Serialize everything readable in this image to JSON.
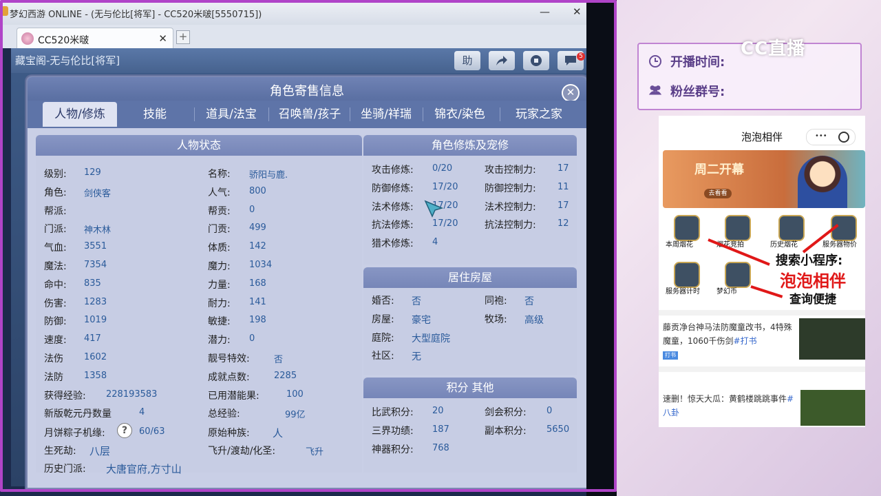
{
  "window": {
    "title": "梦幻西游 ONLINE - (无与伦比[将军] - CC520米啵[5550715])",
    "minimize": "—",
    "close": "✕"
  },
  "browser": {
    "tab_label": "CC520米啵",
    "tab_close": "✕",
    "new_tab": "+"
  },
  "game_bar": {
    "title": "藏宝阁-无与伦比[将军]",
    "help": "助",
    "notify_count": "5"
  },
  "dialog": {
    "title": "角色寄售信息",
    "close": "✕",
    "tabs": [
      "人物/修炼",
      "技能",
      "道具/法宝",
      "召唤兽/孩子",
      "坐骑/祥瑞",
      "锦衣/染色",
      "玩家之家"
    ],
    "active_tab": 0
  },
  "status": {
    "header": "人物状态",
    "left": [
      {
        "label": "级别:",
        "value": "129"
      },
      {
        "label": "角色:",
        "value": "剑侠客"
      },
      {
        "label": "帮派:",
        "value": ""
      },
      {
        "label": "门派:",
        "value": "神木林"
      },
      {
        "label": "气血:",
        "value": "3551"
      },
      {
        "label": "魔法:",
        "value": "7354"
      },
      {
        "label": "命中:",
        "value": "835"
      },
      {
        "label": "伤害:",
        "value": "1283"
      },
      {
        "label": "防御:",
        "value": "1019"
      },
      {
        "label": "速度:",
        "value": "417"
      },
      {
        "label": "法伤",
        "value": "1602"
      },
      {
        "label": "法防",
        "value": "1358"
      }
    ],
    "right": [
      {
        "label": "名称:",
        "value": "骄阳与鹿."
      },
      {
        "label": "人气:",
        "value": "800"
      },
      {
        "label": "帮贡:",
        "value": "0"
      },
      {
        "label": "门贡:",
        "value": "499"
      },
      {
        "label": "体质:",
        "value": "142"
      },
      {
        "label": "魔力:",
        "value": "1034"
      },
      {
        "label": "力量:",
        "value": "168"
      },
      {
        "label": "耐力:",
        "value": "141"
      },
      {
        "label": "敏捷:",
        "value": "198"
      },
      {
        "label": "潜力:",
        "value": "0"
      },
      {
        "label": "靓号特效:",
        "value": "否"
      },
      {
        "label": "成就点数:",
        "value": "2285"
      }
    ],
    "extra": {
      "exp_label": "获得经验:",
      "exp_value": "228193583",
      "potential_label": "已用潜能果:",
      "potential_value": "100",
      "qianyuan_label": "新版乾元丹数量",
      "qianyuan_value": "4",
      "total_exp_label": "总经验:",
      "total_exp_value": "99亿",
      "mooncake_label": "月饼粽子机缘:",
      "mooncake_help": "?",
      "mooncake_value": "60/63",
      "race_label": "原始种族:",
      "race_value": "人",
      "life_label": "生死劫:",
      "life_value": "八层",
      "ascend_label": "飞升/渡劫/化圣:",
      "ascend_value": "飞升",
      "history_label": "历史门派:",
      "history_value": "大唐官府,方寸山"
    }
  },
  "cultivation": {
    "header": "角色修炼及宠修",
    "rows": [
      {
        "label": "攻击修炼:",
        "value": "0/20",
        "label2": "攻击控制力:",
        "value2": "17"
      },
      {
        "label": "防御修炼:",
        "value": "17/20",
        "label2": "防御控制力:",
        "value2": "11"
      },
      {
        "label": "法术修炼:",
        "value": "17/20",
        "label2": "法术控制力:",
        "value2": "17"
      },
      {
        "label": "抗法修炼:",
        "value": "17/20",
        "label2": "抗法控制力:",
        "value2": "12"
      },
      {
        "label": "猎术修炼:",
        "value": "4",
        "label2": "",
        "value2": ""
      }
    ]
  },
  "housing": {
    "header": "居住房屋",
    "rows": [
      {
        "label": "婚否:",
        "value": "否",
        "label2": "同袍:",
        "value2": "否"
      },
      {
        "label": "房屋:",
        "value": "豪宅",
        "label2": "牧场:",
        "value2": "高级"
      },
      {
        "label": "庭院:",
        "value": "大型庭院",
        "label2": "",
        "value2": ""
      },
      {
        "label": "社区:",
        "value": "无",
        "label2": "",
        "value2": ""
      }
    ]
  },
  "points": {
    "header": "积分 其他",
    "rows": [
      {
        "label": "比武积分:",
        "value": "20",
        "label2": "剑会积分:",
        "value2": "0"
      },
      {
        "label": "三界功绩:",
        "value": "187",
        "label2": "副本积分:",
        "value2": "5650"
      },
      {
        "label": "神器积分:",
        "value": "768",
        "label2": "",
        "value2": ""
      }
    ]
  },
  "live": {
    "start_time_label": "开播时间:",
    "fan_group_label": "粉丝群号:",
    "logo": "CC直播"
  },
  "miniprogram": {
    "title": "泡泡相伴",
    "banner_text": "周二开幕",
    "banner_button": "去看看",
    "icons": [
      "本周烟花",
      "烟花竞拍",
      "历史烟花",
      "服务器物价",
      "服务器计时",
      "梦幻币"
    ],
    "promo_line1": "搜索小程序:",
    "promo_line2": "泡泡相伴",
    "promo_line3": "查询便捷",
    "news": [
      {
        "text": "藤贡净台神马法防魔童改书，4特殊魔童，1060千伤剑",
        "tag": "#打书",
        "badge": "打书"
      },
      {
        "text": "速删！惊天大瓜：黄鹤楼跳跳事件",
        "tag": "#八卦",
        "badge": ""
      }
    ]
  }
}
